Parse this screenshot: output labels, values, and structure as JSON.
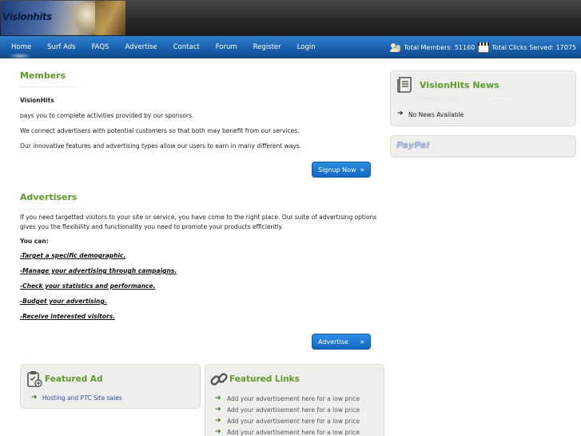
{
  "header": {
    "logo_text": "Visionhits"
  },
  "nav": {
    "items": [
      "Home",
      "Surf Ads",
      "FAQS",
      "Advertise",
      "Contact",
      "Forum",
      "Register",
      "Login"
    ]
  },
  "stats": {
    "members_label": "Total Members: 51160",
    "clicks_label": "Total Clicks Served: 17075"
  },
  "members": {
    "title": "Members",
    "brand": "VisionHits",
    "lines": [
      "pays you to complete activities provided by our sponsors.",
      "We connect advertisers with potential customers so that both may benefit from our services.",
      "Our innovative features and advertising types allow our users to earn in many different ways."
    ],
    "button": "Signup Now"
  },
  "advertisers": {
    "title": "Advertisers",
    "line1": "If you need targetted visitors to your site or service, you have come to the right place. Our suite of advertising options",
    "line2": "gives you the flexibility and functionality you need to promote your products efficiently.",
    "you_can": "You can:",
    "benefits": [
      "-Target a specific demographic.",
      "-Manage your advertising through campaigns.",
      "-Check your statistics and performance.",
      "-Budget your advertising.",
      "-Receive interested visitors."
    ],
    "button": "Advertise"
  },
  "featured_ad": {
    "title": "Featured Ad",
    "link": "Hosting and PTC Site sales"
  },
  "featured_links": {
    "title": "Featured Links",
    "items": [
      "Add your advertisement here for a low price",
      "Add your advertisement here for a low price",
      "Add your advertisement here for a low price",
      "Add your advertisement here for a low price"
    ]
  },
  "news": {
    "title": "VisionHits News",
    "item": "No News Available"
  },
  "paypal": {
    "logo_text": "PayPal"
  },
  "icons": {
    "arrow": "arrow-right-icon",
    "users": "users-icon",
    "clicks": "clapperboard-icon"
  },
  "colors": {
    "accent_green": "#5e9a2a",
    "nav_blue": "#1b62ae",
    "button_blue": "#1367c2"
  }
}
